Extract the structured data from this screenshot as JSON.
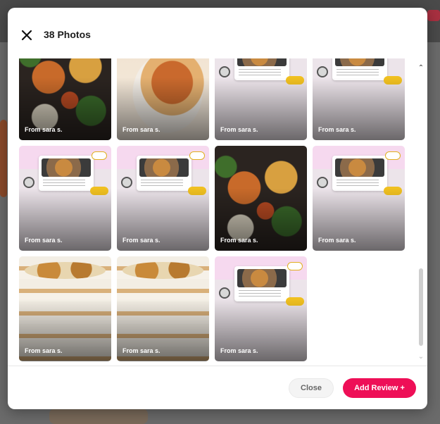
{
  "modal": {
    "title": "38 Photos",
    "close_icon": "close-icon"
  },
  "photos": [
    {
      "credit": "From sara s.",
      "kind": "spread"
    },
    {
      "credit": "From sara s.",
      "kind": "lasagna"
    },
    {
      "credit": "From sara s.",
      "kind": "review"
    },
    {
      "credit": "From sara s.",
      "kind": "review"
    },
    {
      "credit": "From sara s.",
      "kind": "review"
    },
    {
      "credit": "From sara s.",
      "kind": "review"
    },
    {
      "credit": "From sara s.",
      "kind": "spread"
    },
    {
      "credit": "From sara s.",
      "kind": "review"
    },
    {
      "credit": "From sara s.",
      "kind": "trifle"
    },
    {
      "credit": "From sara s.",
      "kind": "trifle"
    },
    {
      "credit": "From sara s.",
      "kind": "review"
    }
  ],
  "footer": {
    "close_label": "Close",
    "add_review_label": "Add Review +"
  },
  "colors": {
    "accent": "#ee0f57"
  },
  "scroll": {
    "up_icon": "chevron-up-icon",
    "down_icon": "chevron-down-icon"
  }
}
